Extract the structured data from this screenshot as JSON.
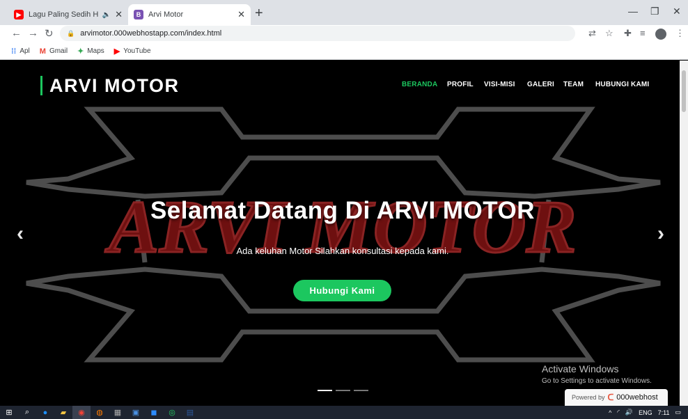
{
  "browser": {
    "tabs": [
      {
        "title": "Lagu Paling Sedih HAPPY AS",
        "favicon": "youtube-icon",
        "color": "#ff0000"
      },
      {
        "title": "Arvi Motor",
        "favicon": "bootstrap-icon",
        "color": "#7952b3",
        "letter": "B"
      }
    ],
    "url": "arvimotor.000webhostapp.com/index.html",
    "bookmarks": [
      {
        "label": "Apl",
        "icon": "apps-grid-icon"
      },
      {
        "label": "Gmail",
        "icon": "gmail-icon",
        "letter": "M"
      },
      {
        "label": "Maps",
        "icon": "maps-icon"
      },
      {
        "label": "YouTube",
        "icon": "youtube-icon"
      }
    ]
  },
  "site": {
    "brand": "ARVI MOTOR",
    "nav": [
      "BERANDA",
      "PROFIL",
      "VISI-MISI",
      "GALERI",
      "TEAM",
      "HUBUNGI KAMI"
    ],
    "hero": {
      "title": "Selamat Datang Di ARVI MOTOR",
      "subtitle": "Ada keluhan Motor Silahkan konsultasi kepada kami.",
      "cta": "Hubungi Kami"
    },
    "accent": "#1cc75f",
    "watermark": "ARVI MOTOR"
  },
  "overlay": {
    "activate_title": "Activate Windows",
    "activate_sub": "Go to Settings to activate Windows.",
    "powered_prefix": "Powered by",
    "powered_brand": "000webhost"
  },
  "taskbar": {
    "lang": "ENG",
    "time": "7:11"
  }
}
